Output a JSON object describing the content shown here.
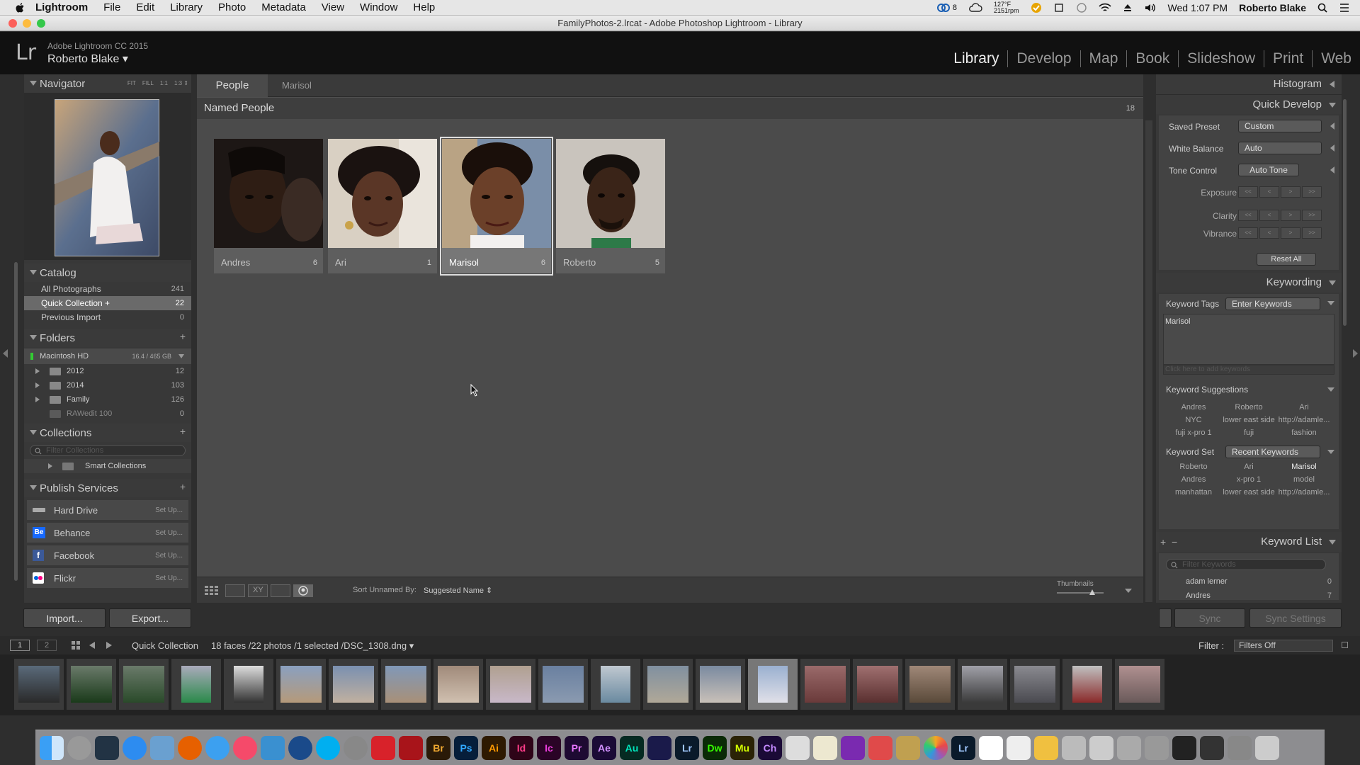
{
  "menubar": {
    "app": "Lightroom",
    "items": [
      "File",
      "Edit",
      "Library",
      "Photo",
      "Metadata",
      "View",
      "Window",
      "Help"
    ],
    "status": {
      "weather_top": "127°F",
      "weather_bottom": "2151rpm",
      "cc_badge": "8",
      "clock": "Wed 1:07 PM",
      "user": "Roberto Blake"
    }
  },
  "window": {
    "title": "FamilyPhotos-2.lrcat - Adobe Photoshop Lightroom - Library"
  },
  "identity": {
    "logo": "Lr",
    "product": "Adobe Lightroom CC 2015",
    "user": "Roberto Blake ▾"
  },
  "modules": [
    "Library",
    "Develop",
    "Map",
    "Book",
    "Slideshow",
    "Print",
    "Web"
  ],
  "left": {
    "navigator": {
      "title": "Navigator",
      "zoom_options": [
        "FIT",
        "FILL",
        "1:1",
        "1:3 ⇕"
      ]
    },
    "catalog": {
      "title": "Catalog",
      "items": [
        {
          "label": "All Photographs",
          "count": "241"
        },
        {
          "label": "Quick Collection +",
          "count": "22"
        },
        {
          "label": "Previous Import",
          "count": "0"
        }
      ]
    },
    "folders": {
      "title": "Folders",
      "volume": "Macintosh HD",
      "volume_info": "16.4 / 465 GB",
      "items": [
        {
          "label": "2012",
          "count": "12"
        },
        {
          "label": "2014",
          "count": "103"
        },
        {
          "label": "Family",
          "count": "126"
        },
        {
          "label": "RAWedit 100",
          "count": "0"
        }
      ]
    },
    "collections": {
      "title": "Collections",
      "filter_placeholder": "Filter Collections",
      "smart": "Smart Collections"
    },
    "publish": {
      "title": "Publish Services",
      "setup": "Set Up...",
      "items": [
        "Hard Drive",
        "Behance",
        "Facebook",
        "Flickr"
      ]
    },
    "import_label": "Import...",
    "export_label": "Export..."
  },
  "center": {
    "tab": "People",
    "crumb": "Marisol",
    "named_title": "Named People",
    "named_count": "18",
    "faces": [
      {
        "name": "Andres",
        "count": "6"
      },
      {
        "name": "Ari",
        "count": "1"
      },
      {
        "name": "Marisol",
        "count": "6"
      },
      {
        "name": "Roberto",
        "count": "5"
      }
    ],
    "toolbar": {
      "sort_label": "Sort Unnamed By:",
      "sort_value": "Suggested Name ⇕",
      "thumbs_label": "Thumbnails"
    }
  },
  "right": {
    "histogram": "Histogram",
    "quick_develop": "Quick Develop",
    "saved_preset_label": "Saved Preset",
    "saved_preset_value": "Custom",
    "white_balance_label": "White Balance",
    "white_balance_value": "Auto",
    "tone_control_label": "Tone Control",
    "auto_tone": "Auto Tone",
    "exposure": "Exposure",
    "clarity": "Clarity",
    "vibrance": "Vibrance",
    "reset_all": "Reset All",
    "keywording": "Keywording",
    "keyword_tags_label": "Keyword Tags",
    "keyword_tags_value": "Enter Keywords",
    "keyword_text": "Marisol",
    "keyword_placeholder": "Click here to add keywords",
    "suggestions_title": "Keyword Suggestions",
    "suggestions": [
      "Andres",
      "Roberto",
      "Ari",
      "NYC",
      "lower east side",
      "http://adamle...",
      "fuji x-pro 1",
      "fuji",
      "fashion"
    ],
    "keyword_set_label": "Keyword Set",
    "keyword_set_value": "Recent Keywords",
    "keyword_set": [
      "Roberto",
      "Ari",
      "Marisol",
      "Andres",
      "x-pro 1",
      "model",
      "manhattan",
      "lower east side",
      "http://adamle..."
    ],
    "keyword_list_title": "Keyword List",
    "keyword_filter_placeholder": "Filter Keywords",
    "keyword_list": [
      {
        "label": "adam lerner",
        "count": "0"
      },
      {
        "label": "Andres",
        "count": "7"
      }
    ],
    "sync": "Sync",
    "sync_settings": "Sync Settings"
  },
  "filmbar": {
    "page1": "1",
    "page2": "2",
    "source": "Quick Collection",
    "info": "18 faces /22 photos /1 selected /DSC_1308.dng ▾",
    "filter_label": "Filter :",
    "filter_value": "Filters Off"
  },
  "dock": [
    "Br",
    "Ps",
    "Ai",
    "Id",
    "Ic",
    "Pr",
    "Ae",
    "Au",
    "Lr",
    "Dw",
    "Mu",
    "Ch",
    "Lr"
  ]
}
